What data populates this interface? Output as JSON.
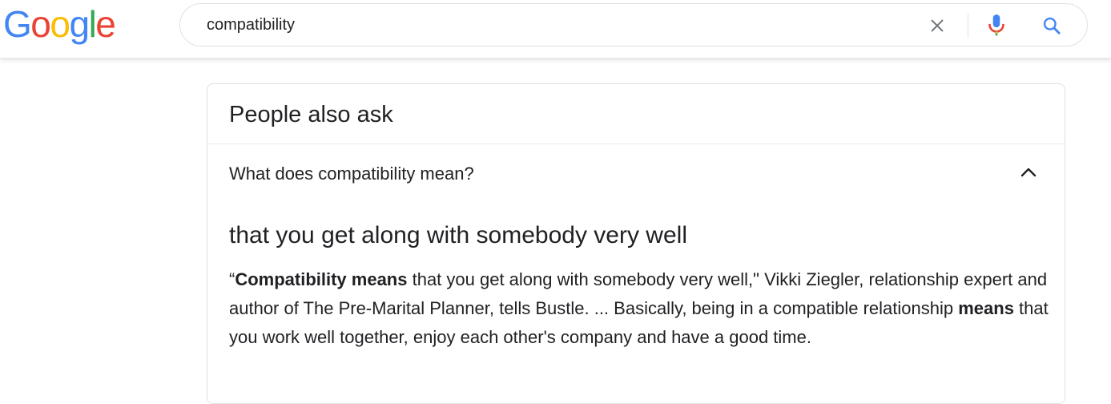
{
  "logo": {
    "letters": [
      {
        "char": "G",
        "color": "#4285F4"
      },
      {
        "char": "o",
        "color": "#EA4335"
      },
      {
        "char": "o",
        "color": "#FBBC05"
      },
      {
        "char": "g",
        "color": "#4285F4"
      },
      {
        "char": "l",
        "color": "#34A853"
      },
      {
        "char": "e",
        "color": "#EA4335"
      }
    ]
  },
  "search": {
    "value": "compatibility",
    "clear_icon": "close-icon",
    "voice_icon": "microphone-icon",
    "search_icon": "search-icon",
    "accent_color": "#4285F4"
  },
  "paa": {
    "title": "People also ask",
    "question": "What does compatibility mean?",
    "expanded": true,
    "answer_heading": "that you get along with somebody very well",
    "snippet": {
      "open_quote": "“",
      "bold_1": "Compatibility means",
      "text_1": " that you get along with somebody very well,\" Vikki Ziegler, relationship expert and author of The Pre-Marital Planner, tells Bustle. ... Basically, being in a compatible relationship ",
      "bold_2": "means",
      "text_2": " that you work well together, enjoy each other's company and have a good time."
    }
  }
}
